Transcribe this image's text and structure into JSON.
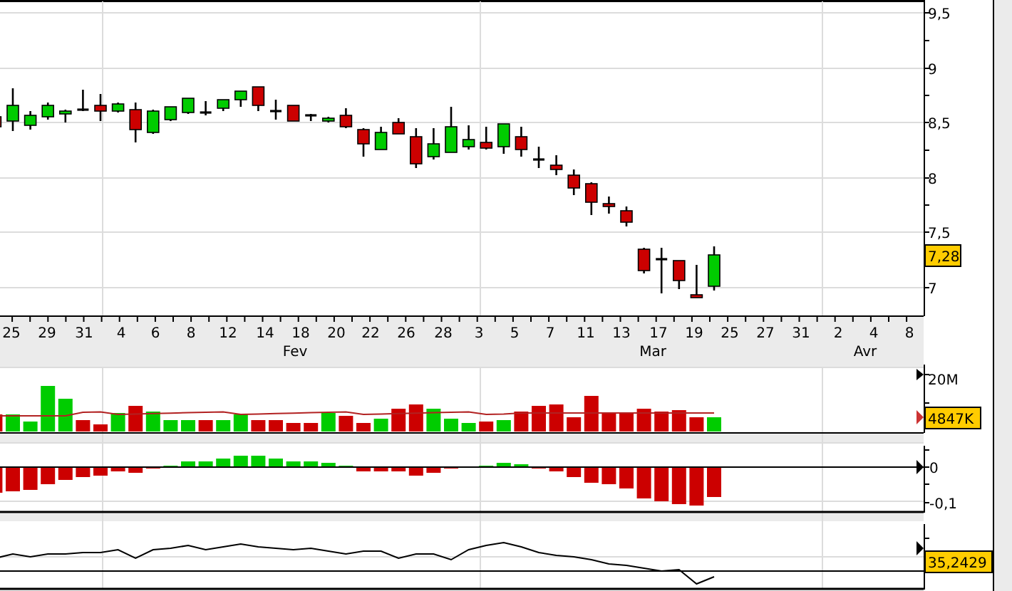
{
  "price_axis": {
    "labels": [
      "9,5",
      "9",
      "8,5",
      "8",
      "7,5",
      "7"
    ],
    "last_price_badge": "7,28"
  },
  "date_axis": {
    "days": [
      "25",
      "29",
      "31",
      "4",
      "6",
      "8",
      "12",
      "14",
      "18",
      "20",
      "22",
      "26",
      "28",
      "3",
      "5",
      "7",
      "11",
      "13",
      "17",
      "19",
      "25",
      "27",
      "31",
      "2",
      "4",
      "8"
    ],
    "months": [
      "Fev",
      "Mar",
      "Avr"
    ]
  },
  "volume_panel": {
    "axis_label": "20M",
    "value_badge": "4847K"
  },
  "oscillator_panel": {
    "axis_labels": [
      "0",
      "-0,1"
    ]
  },
  "line_panel": {
    "value_badge": "35,2429"
  }
}
